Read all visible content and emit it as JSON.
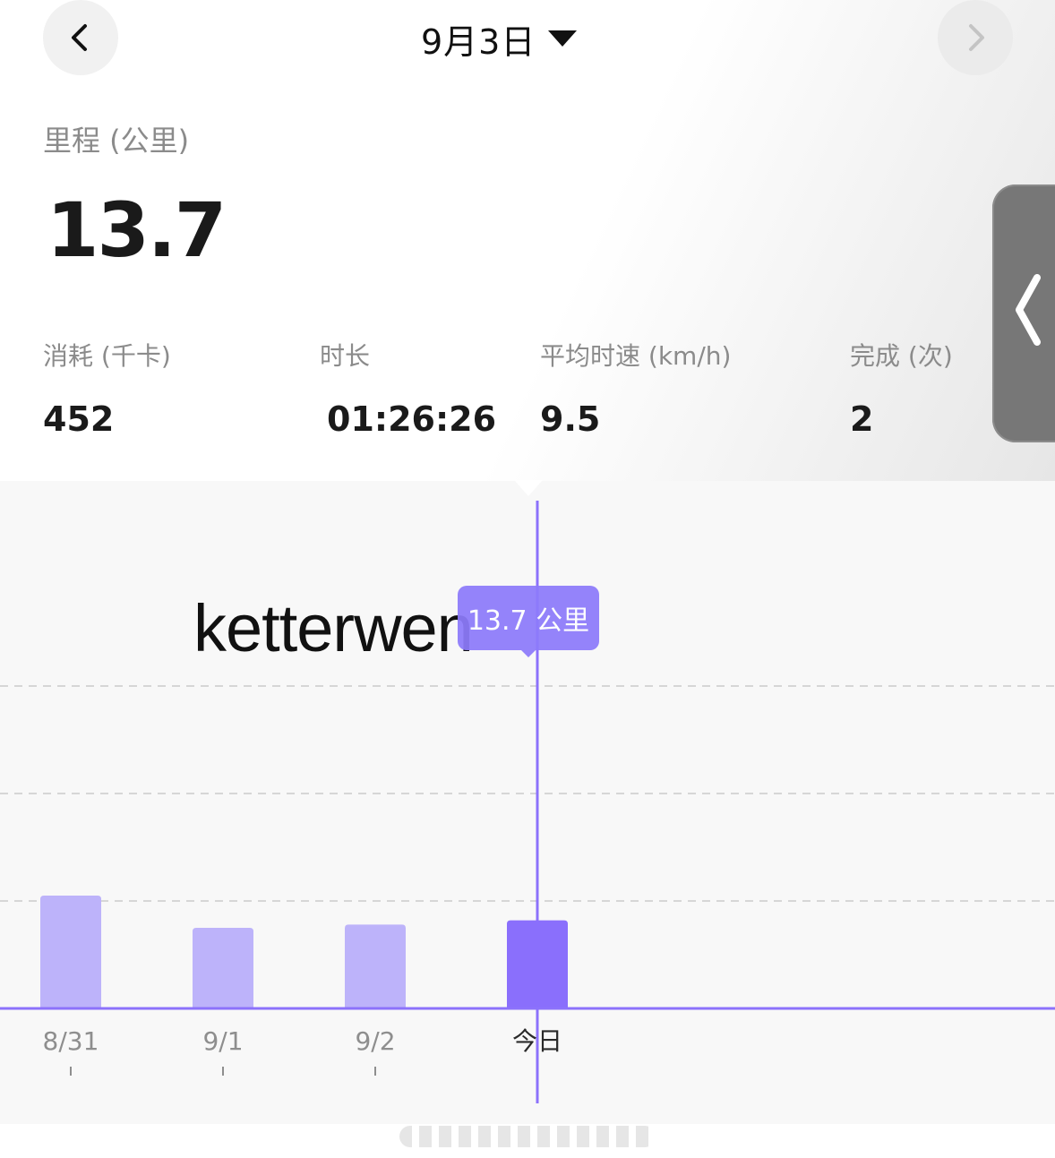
{
  "header": {
    "date_label": "9月3日",
    "prev_icon": "chevron-left-icon",
    "next_icon": "chevron-right-icon",
    "dropdown_icon": "caret-down-icon"
  },
  "summary": {
    "title": "里程 (公里)",
    "value": "13.7"
  },
  "stats": [
    {
      "label": "消耗 (千卡)",
      "value": "452"
    },
    {
      "label": "时长",
      "value": "01:26:26"
    },
    {
      "label": "平均时速 (km/h)",
      "value": "9.5"
    },
    {
      "label": "完成 (次)",
      "value": "2"
    }
  ],
  "side_handle": {
    "icon": "chevron-left-icon"
  },
  "watermark": "ketterwen",
  "tooltip": "13.7 公里",
  "colors": {
    "accent": "#8c72fb",
    "bar_inactive": "#bdb3fa",
    "bar_active": "#8a6ffc",
    "gridline": "#d6d6d6",
    "chart_bg": "#f8f8f8"
  },
  "chart_data": {
    "type": "bar",
    "categories": [
      "8/31",
      "9/1",
      "9/2",
      "今日"
    ],
    "values": [
      10.5,
      7.5,
      7.8,
      8.2
    ],
    "selected_index": 3,
    "ylim": [
      0,
      30
    ],
    "grid": true,
    "xlabel": "",
    "ylabel": ""
  }
}
